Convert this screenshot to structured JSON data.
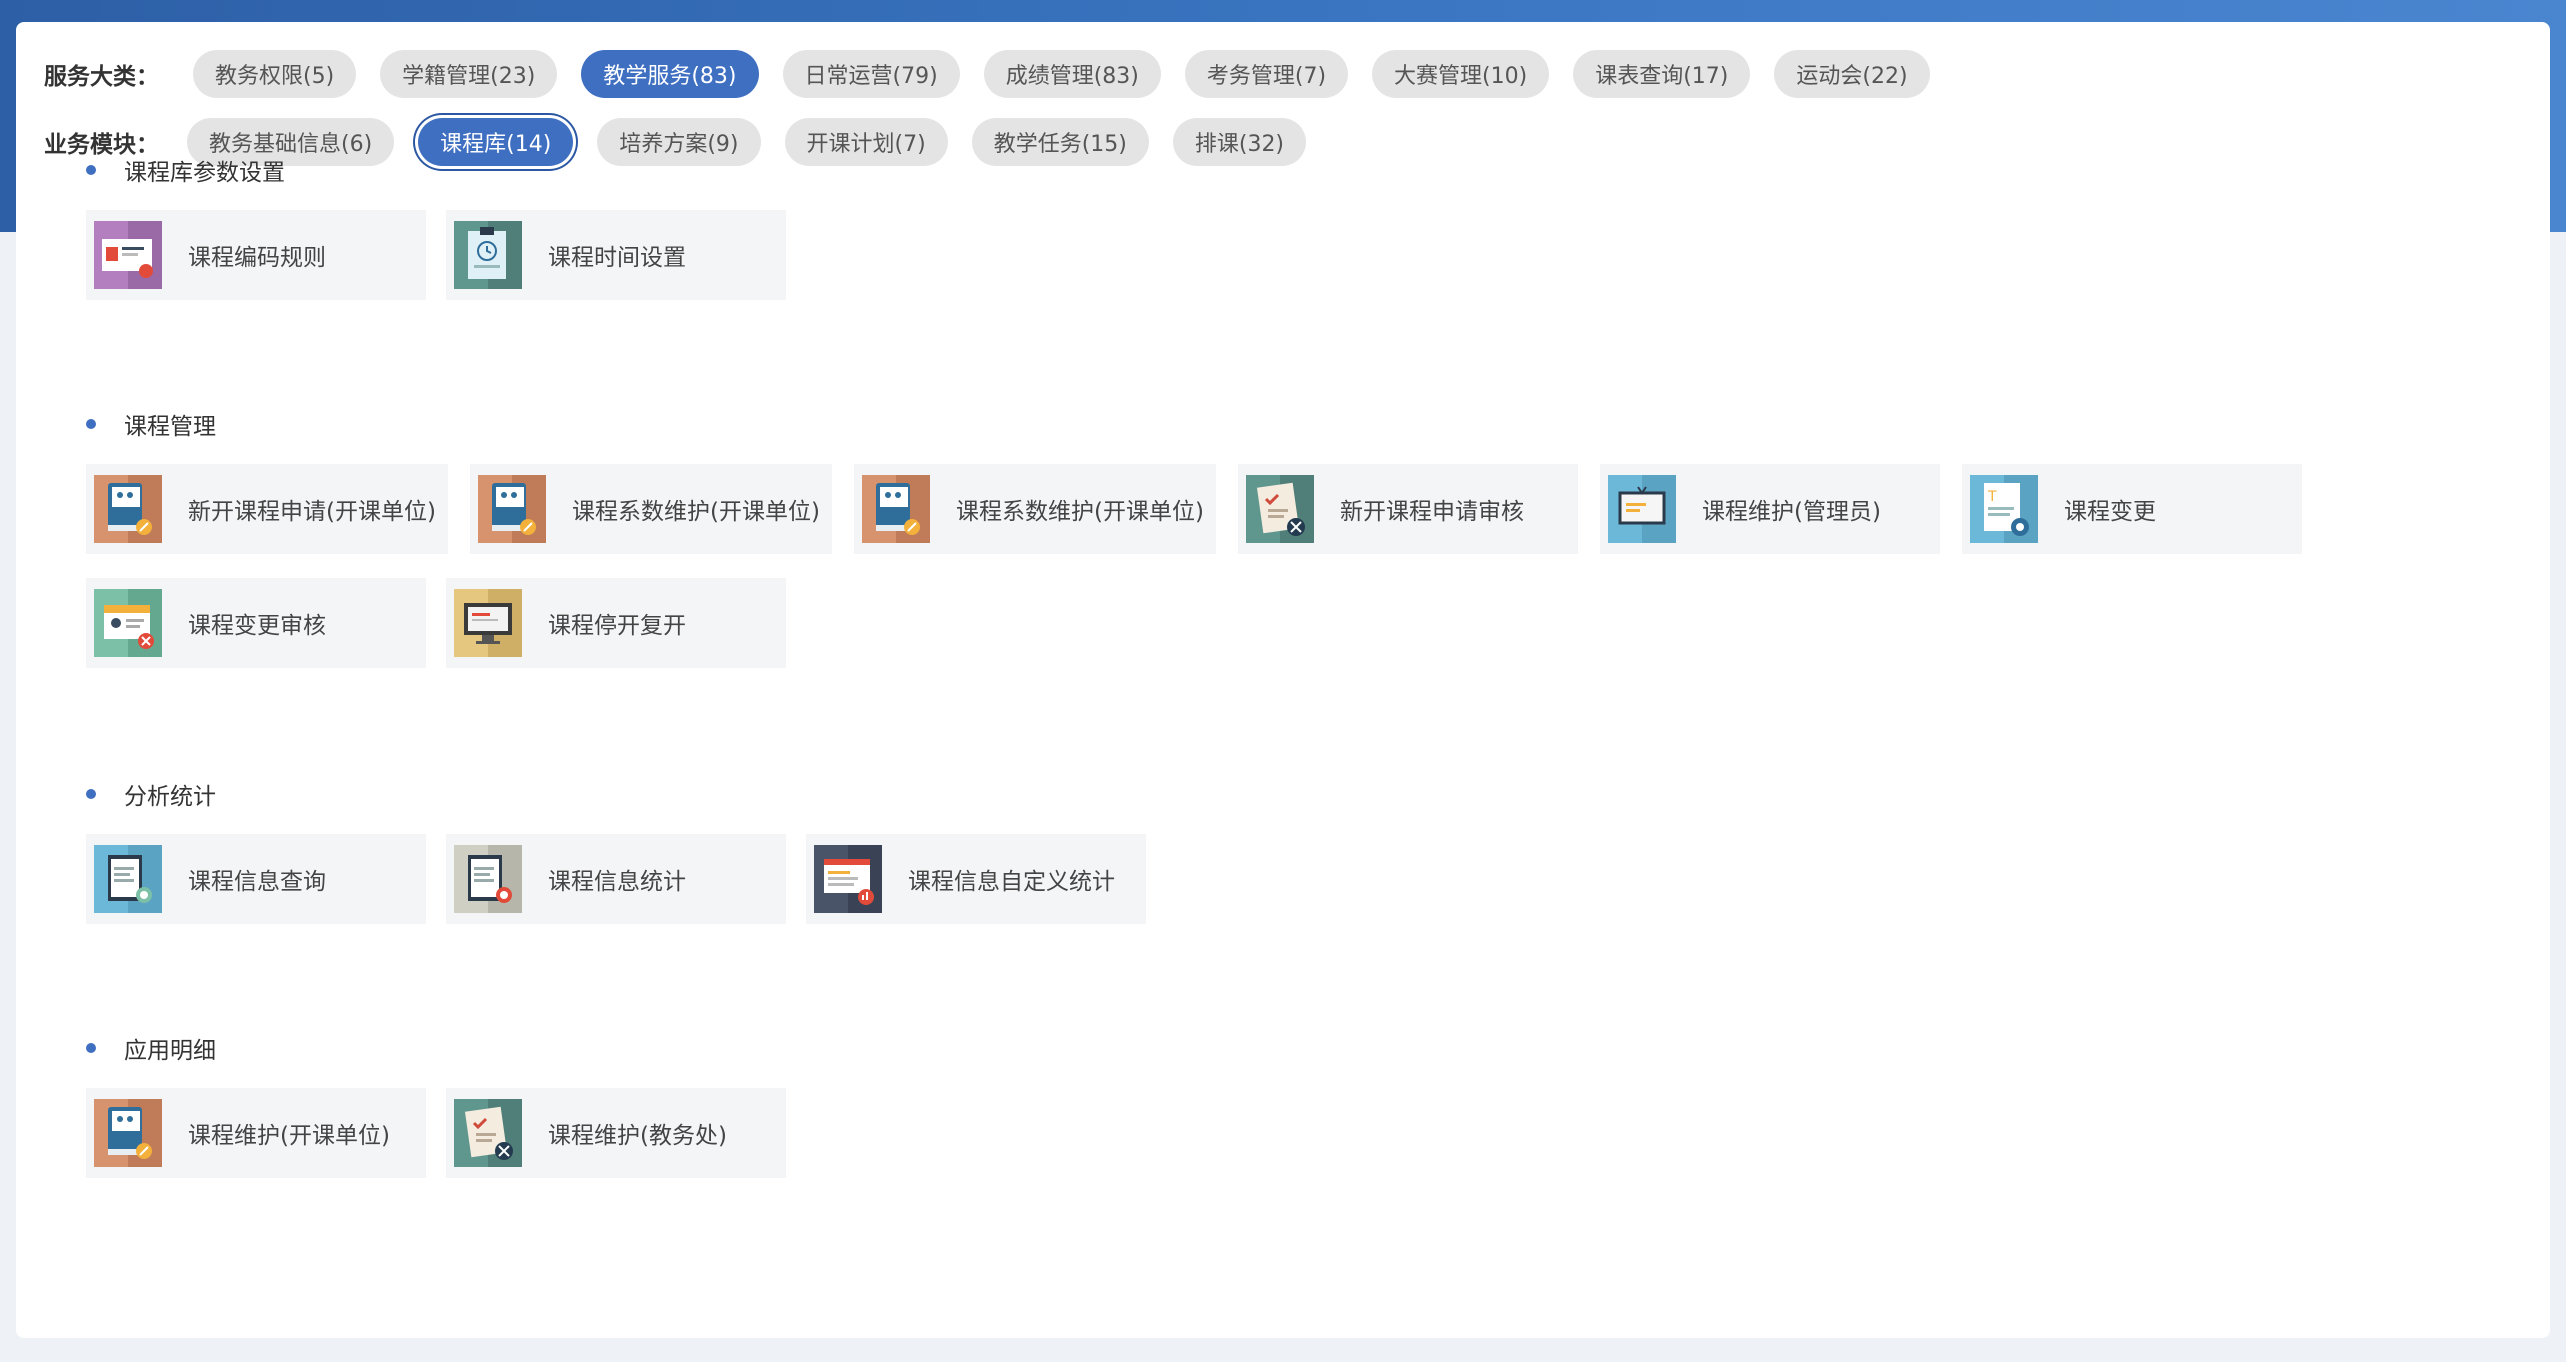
{
  "filters": {
    "category_label": "服务大类：",
    "categories": [
      {
        "label": "教务权限(5)",
        "active": false
      },
      {
        "label": "学籍管理(23)",
        "active": false
      },
      {
        "label": "教学服务(83)",
        "active": true
      },
      {
        "label": "日常运营(79)",
        "active": false
      },
      {
        "label": "成绩管理(83)",
        "active": false
      },
      {
        "label": "考务管理(7)",
        "active": false
      },
      {
        "label": "大赛管理(10)",
        "active": false
      },
      {
        "label": "课表查询(17)",
        "active": false
      },
      {
        "label": "运动会(22)",
        "active": false
      }
    ],
    "module_label": "业务模块：",
    "modules": [
      {
        "label": "教务基础信息(6)",
        "active": false
      },
      {
        "label": "课程库(14)",
        "active": true
      },
      {
        "label": "培养方案(9)",
        "active": false
      },
      {
        "label": "开课计划(7)",
        "active": false
      },
      {
        "label": "教学任务(15)",
        "active": false
      },
      {
        "label": "排课(32)",
        "active": false
      }
    ]
  },
  "sections": [
    {
      "title": "课程库参数设置",
      "items": [
        {
          "label": "课程编码规则",
          "icon": "course-code-rule-icon",
          "color_left": "#b37fbf",
          "color_right": "#9a6aa7"
        },
        {
          "label": "课程时间设置",
          "icon": "course-time-clipboard-icon",
          "color_left": "#5f968e",
          "color_right": "#4f7f78"
        }
      ]
    },
    {
      "title": "课程管理",
      "items": [
        {
          "label": "新开课程申请(开课单位)",
          "icon": "book-wrench-icon",
          "color_left": "#d7926e",
          "color_right": "#c07c59"
        },
        {
          "label": "课程系数维护(开课单位)",
          "icon": "book-wrench-icon",
          "color_left": "#d7926e",
          "color_right": "#c07c59"
        },
        {
          "label": "课程系数维护(开课单位)",
          "icon": "book-wrench-icon",
          "color_left": "#d7926e",
          "color_right": "#c07c59"
        },
        {
          "label": "新开课程申请审核",
          "icon": "checklist-tools-icon",
          "color_left": "#5f968e",
          "color_right": "#4f7f78"
        },
        {
          "label": "课程维护(管理员)",
          "icon": "presentation-board-icon",
          "color_left": "#6cb8d8",
          "color_right": "#5aa3c2"
        },
        {
          "label": "课程变更",
          "icon": "document-settings-icon",
          "color_left": "#6cb8d8",
          "color_right": "#5aa3c2"
        },
        {
          "label": "课程变更审核",
          "icon": "id-card-check-icon",
          "color_left": "#7cc0a8",
          "color_right": "#65a890"
        },
        {
          "label": "课程停开复开",
          "icon": "monitor-icon",
          "color_left": "#e6c77f",
          "color_right": "#cfae66"
        }
      ]
    },
    {
      "title": "分析统计",
      "items": [
        {
          "label": "课程信息查询",
          "icon": "clipboard-search-icon",
          "color_left": "#6cb8d8",
          "color_right": "#5aa3c2"
        },
        {
          "label": "课程信息统计",
          "icon": "clipboard-stats-icon",
          "color_left": "#cfcfc4",
          "color_right": "#b6b6aa"
        },
        {
          "label": "课程信息自定义统计",
          "icon": "custom-report-icon",
          "color_left": "#4a5468",
          "color_right": "#3a4356"
        }
      ]
    },
    {
      "title": "应用明细",
      "items": [
        {
          "label": "课程维护(开课单位)",
          "icon": "book-wrench-icon",
          "color_left": "#d7926e",
          "color_right": "#c07c59"
        },
        {
          "label": "课程维护(教务处)",
          "icon": "checklist-tools-icon",
          "color_left": "#5f968e",
          "color_right": "#4f7f78"
        }
      ]
    }
  ],
  "colors": {
    "accent": "#3f6fc1",
    "header_band": "#3a76c2",
    "chip_bg": "#e4e4e4",
    "card_bg": "#f4f5f7"
  }
}
